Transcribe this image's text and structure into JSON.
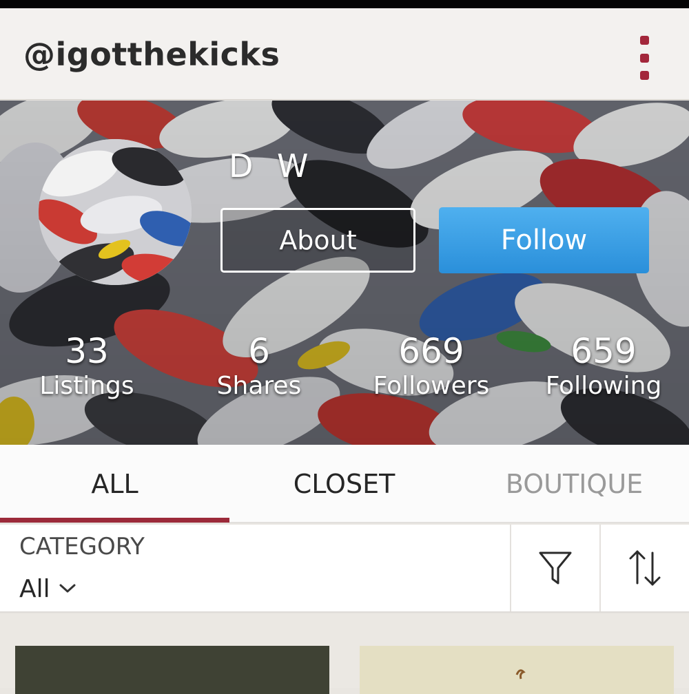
{
  "app_bar": {
    "title": "@igotthekicks",
    "menu_icon": "more-vert-icon",
    "accent_color": "#a3273b"
  },
  "profile": {
    "name": "D W",
    "about_label": "About",
    "follow_label": "Follow",
    "follow_color": "#3a9de3",
    "stats": [
      {
        "value": "33",
        "label": "Listings"
      },
      {
        "value": "6",
        "label": "Shares"
      },
      {
        "value": "669",
        "label": "Followers"
      },
      {
        "value": "659",
        "label": "Following"
      }
    ]
  },
  "tabs": {
    "items": [
      {
        "label": "ALL",
        "selected": true
      },
      {
        "label": "CLOSET",
        "selected": false
      },
      {
        "label": "BOUTIQUE",
        "selected": false
      }
    ],
    "indicator_color": "#9c2a3a"
  },
  "filter_bar": {
    "category_label": "CATEGORY",
    "category_value": "All",
    "filter_icon": "filter-funnel-icon",
    "sort_icon": "sort-arrows-icon"
  }
}
